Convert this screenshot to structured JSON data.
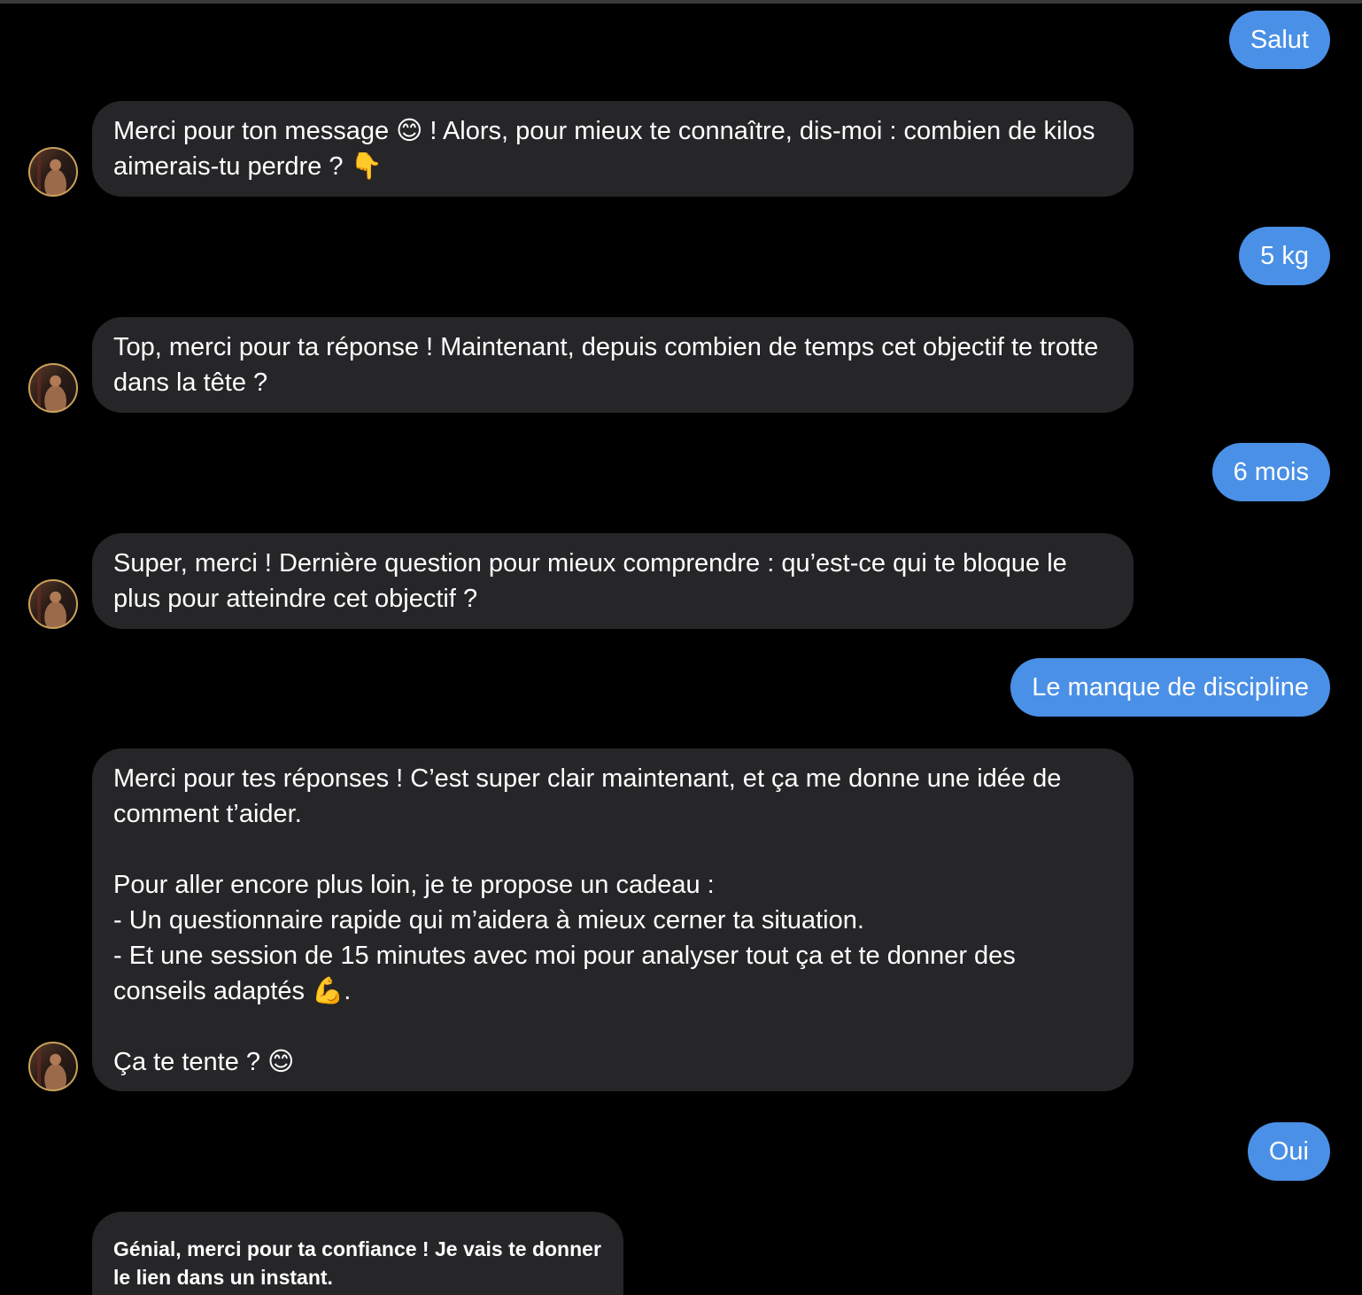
{
  "conversation": {
    "messages": [
      {
        "from": "user",
        "text": "Salut"
      },
      {
        "from": "bot",
        "text": "Merci pour ton message 😊 ! Alors, pour mieux te connaître, dis-moi : combien de kilos aimerais-tu perdre ? 👇"
      },
      {
        "from": "user",
        "text": "5 kg"
      },
      {
        "from": "bot",
        "text": "Top, merci pour ta réponse ! Maintenant, depuis combien de temps cet objectif te trotte dans la tête ?"
      },
      {
        "from": "user",
        "text": "6 mois"
      },
      {
        "from": "bot",
        "text": "Super, merci ! Dernière question pour mieux comprendre : qu’est-ce qui te bloque le plus pour atteindre cet objectif ?"
      },
      {
        "from": "user",
        "text": "Le manque de discipline"
      },
      {
        "from": "bot",
        "text": "Merci pour tes réponses ! C’est super clair maintenant, et ça me donne une idée de comment t’aider.\n\nPour aller encore plus loin, je te propose un cadeau :\n- Un questionnaire rapide qui m’aidera à mieux cerner ta situation.\n- Et une session de 15 minutes avec moi pour analyser tout ça et te donner des conseils adaptés 💪.\n\nÇa te tente ? 😊"
      },
      {
        "from": "user",
        "text": "Oui"
      },
      {
        "from": "bot",
        "text": "Génial, merci pour ta confiance ! Je vais te donner le lien dans un instant."
      }
    ]
  },
  "colors": {
    "background": "#000000",
    "outgoing_bubble": "#4a90e6",
    "incoming_bubble": "#262628",
    "avatar_ring": "#c9a25a"
  },
  "icons": {
    "avatar": "profile-photo"
  }
}
